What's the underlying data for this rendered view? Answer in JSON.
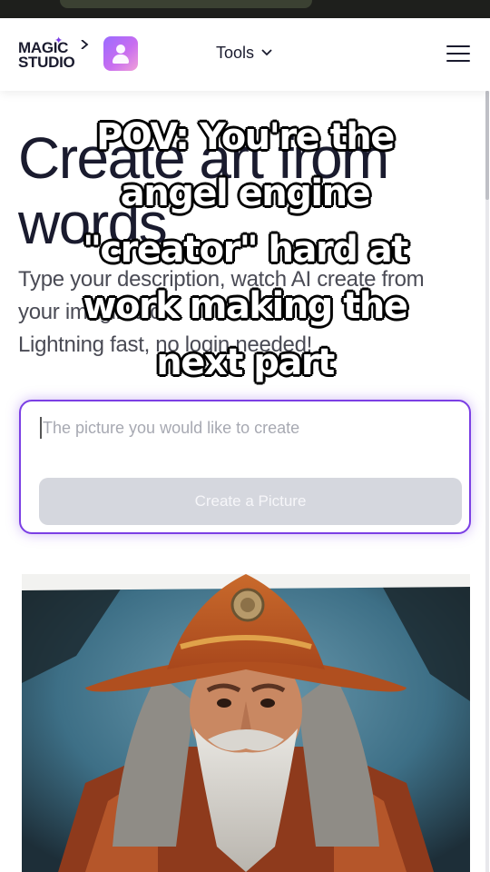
{
  "header": {
    "logo_line1": "MAGIC",
    "logo_line2": "STUDIO",
    "tools_label": "Tools"
  },
  "hero": {
    "title": "Create art from words",
    "subtitle": "Type your description, watch AI create from your imagination.",
    "subtitle2": "Lightning fast, no login needed!"
  },
  "prompt": {
    "placeholder": "The picture you would like to create",
    "value": "",
    "button_label": "Create a Picture"
  },
  "caption": {
    "lines": [
      "POV: You're the",
      "angel engine",
      "\"creator\" hard at",
      "work making the",
      "next part"
    ]
  },
  "colors": {
    "accent": "#7b3fe4",
    "text_dark": "#1a1b2e",
    "button_disabled": "#d5d7de",
    "top_strip": "#1e1f1c"
  },
  "icons": [
    "sparkle-icon",
    "chevron-right-icon",
    "avatar-app-icon",
    "chevron-down-icon",
    "hamburger-menu-icon"
  ]
}
